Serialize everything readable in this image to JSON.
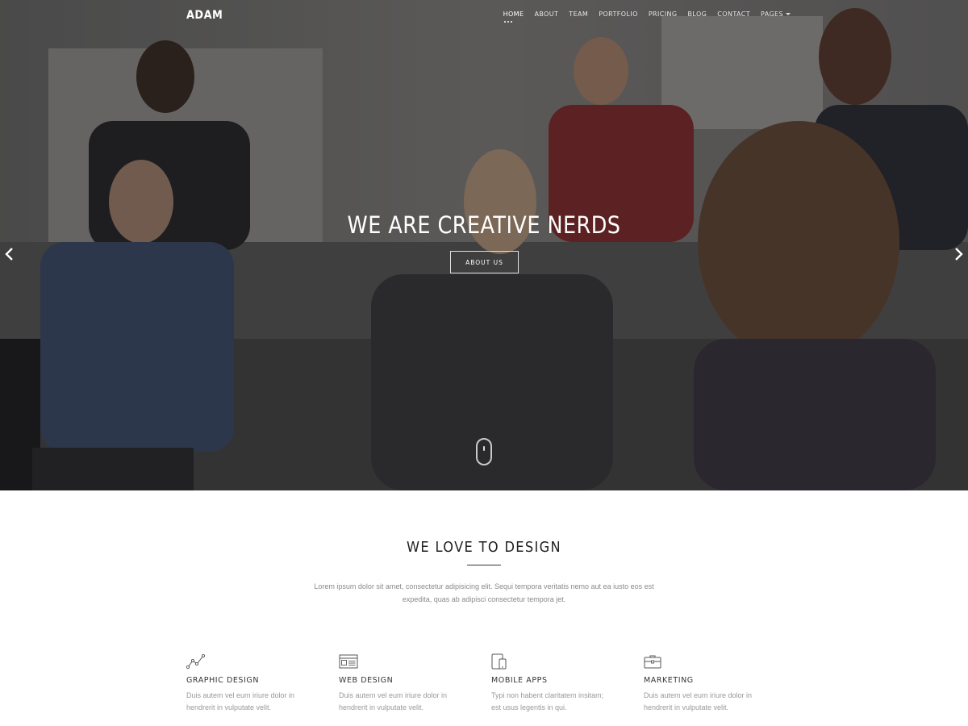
{
  "brand": "ADAM",
  "nav": {
    "items": [
      "HOME",
      "ABOUT",
      "TEAM",
      "PORTFOLIO",
      "PRICING",
      "BLOG",
      "CONTACT",
      "PAGES"
    ],
    "active": "HOME"
  },
  "hero": {
    "title": "WE ARE CREATIVE NERDS",
    "button_label": "ABOUT US"
  },
  "intro": {
    "title": "WE LOVE TO DESIGN",
    "text": "Lorem ipsum dolor sit amet, consectetur adipisicing elit. Sequi tempora veritatis nemo aut ea iusto eos est expedita, quas ab adipisci consectetur tempora jet."
  },
  "services": [
    {
      "icon": "line-chart-icon",
      "title": "GRAPHIC DESIGN",
      "text": "Duis autem vel eum iriure dolor in hendrerit in vulputate velit."
    },
    {
      "icon": "browser-window-icon",
      "title": "WEB DESIGN",
      "text": "Duis autem vel eum iriure dolor in hendrerit in vulputate velit."
    },
    {
      "icon": "mobile-devices-icon",
      "title": "MOBILE APPS",
      "text": "Typi non habent claritatem insitam; est usus legentis in qui."
    },
    {
      "icon": "briefcase-icon",
      "title": "MARKETING",
      "text": "Duis autem vel eum iriure dolor in hendrerit in vulputate velit."
    }
  ],
  "colors": {
    "hero_overlay": "#2a2a2c",
    "text_dark": "#222222",
    "text_muted": "#999999"
  }
}
